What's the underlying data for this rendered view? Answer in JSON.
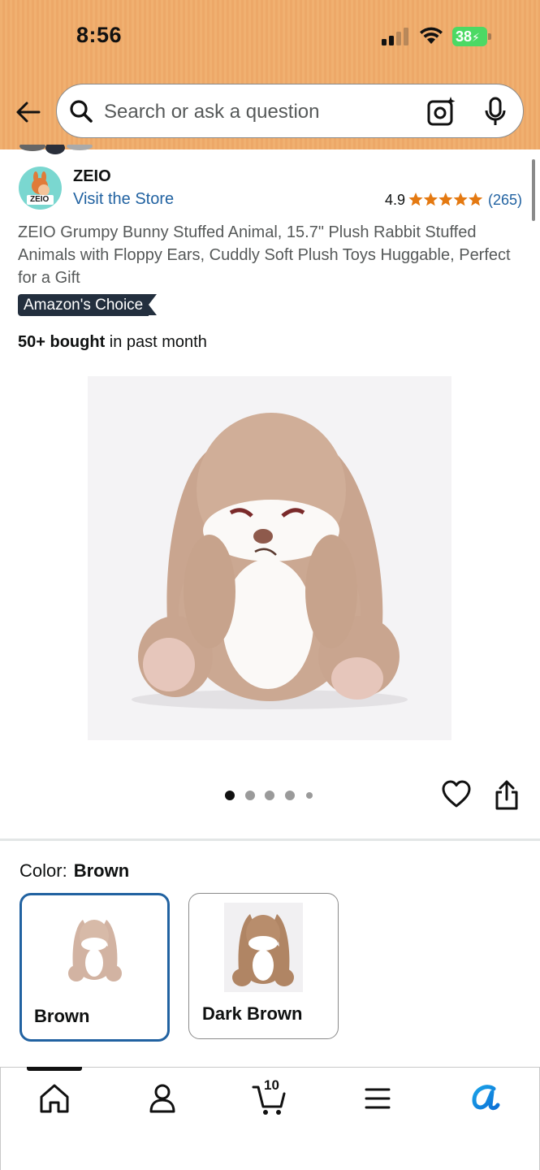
{
  "status_bar": {
    "time": "8:56",
    "battery": "38"
  },
  "search": {
    "placeholder": "Search or ask a question"
  },
  "brand": {
    "name": "ZEIO",
    "logo_text": "ZEIO",
    "visit_store": "Visit the Store"
  },
  "rating": {
    "value": "4.9",
    "stars": 5,
    "count": "(265)"
  },
  "product": {
    "title": "ZEIO Grumpy Bunny Stuffed Animal, 15.7\" Plush Rabbit Stuffed Animals with Floppy Ears, Cuddly Soft Plush Toys Huggable, Perfect for a Gift",
    "badge": "Amazon's Choice",
    "bought_bold": "50+ bought",
    "bought_rest": " in past month"
  },
  "carousel": {
    "total_images": 5,
    "active_index": 0
  },
  "color": {
    "label": "Color:",
    "selected": "Brown",
    "options": [
      {
        "label": "Brown",
        "selected": true
      },
      {
        "label": "Dark Brown",
        "selected": false
      }
    ]
  },
  "bottom_nav": {
    "items": [
      "home-icon",
      "account-icon",
      "cart-icon",
      "menu-icon",
      "rufus-icon"
    ],
    "cart_count": "10"
  },
  "colors": {
    "header": "#f0b070",
    "link": "#2162a1",
    "star": "#e47911",
    "selected_border": "#2162a1",
    "badge_bg": "#232f3e",
    "rufus": "#1aa3e8"
  }
}
